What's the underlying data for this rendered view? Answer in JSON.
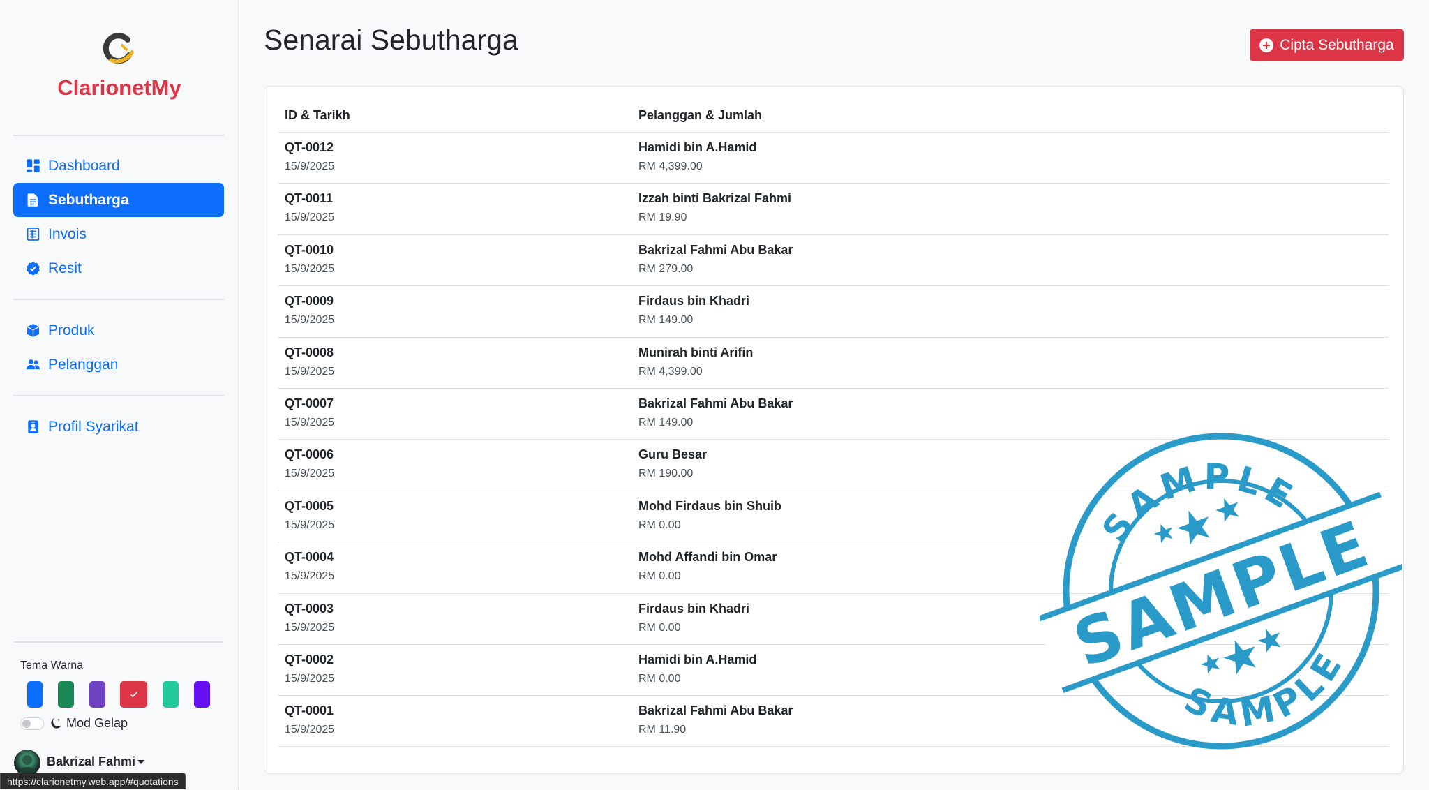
{
  "brand": {
    "name": "ClarionetMy",
    "color": "#dc3545",
    "logo_icon": "brand-logo-icon"
  },
  "sidebar": {
    "nav_main": [
      {
        "label": "Dashboard",
        "icon": "dashboard-icon",
        "active": false
      },
      {
        "label": "Sebutharga",
        "icon": "document-icon",
        "active": true
      },
      {
        "label": "Invois",
        "icon": "invoice-icon",
        "active": false
      },
      {
        "label": "Resit",
        "icon": "badge-check-icon",
        "active": false
      }
    ],
    "nav_data": [
      {
        "label": "Produk",
        "icon": "box-icon"
      },
      {
        "label": "Pelanggan",
        "icon": "people-icon"
      }
    ],
    "nav_settings": [
      {
        "label": "Profil Syarikat",
        "icon": "person-badge-icon"
      }
    ],
    "theme": {
      "label": "Tema Warna",
      "swatches": [
        "#0d6efd",
        "#198754",
        "#6f42c1",
        "#dc3545",
        "#20c997",
        "#6610f2"
      ],
      "selected_index": 3
    },
    "dark_mode": {
      "label": "Mod Gelap",
      "enabled": false
    },
    "user": {
      "name": "Bakrizal Fahmi"
    }
  },
  "status_bar": {
    "url": "https://clarionetmy.web.app/#quotations"
  },
  "main": {
    "title": "Senarai Sebutharga",
    "create_button": "Cipta Sebutharga",
    "table": {
      "headers": [
        "ID & Tarikh",
        "Pelanggan & Jumlah"
      ],
      "rows": [
        {
          "id": "QT-0012",
          "date": "15/9/2025",
          "customer": "Hamidi bin A.Hamid",
          "amount": "RM 4,399.00"
        },
        {
          "id": "QT-0011",
          "date": "15/9/2025",
          "customer": "Izzah binti Bakrizal Fahmi",
          "amount": "RM 19.90"
        },
        {
          "id": "QT-0010",
          "date": "15/9/2025",
          "customer": "Bakrizal Fahmi Abu Bakar",
          "amount": "RM 279.00"
        },
        {
          "id": "QT-0009",
          "date": "15/9/2025",
          "customer": "Firdaus bin Khadri",
          "amount": "RM 149.00"
        },
        {
          "id": "QT-0008",
          "date": "15/9/2025",
          "customer": "Munirah binti Arifin",
          "amount": "RM 4,399.00"
        },
        {
          "id": "QT-0007",
          "date": "15/9/2025",
          "customer": "Bakrizal Fahmi Abu Bakar",
          "amount": "RM 149.00"
        },
        {
          "id": "QT-0006",
          "date": "15/9/2025",
          "customer": "Guru Besar",
          "amount": "RM 190.00"
        },
        {
          "id": "QT-0005",
          "date": "15/9/2025",
          "customer": "Mohd Firdaus bin Shuib",
          "amount": "RM 0.00"
        },
        {
          "id": "QT-0004",
          "date": "15/9/2025",
          "customer": "Mohd Affandi bin Omar",
          "amount": "RM 0.00"
        },
        {
          "id": "QT-0003",
          "date": "15/9/2025",
          "customer": "Firdaus bin Khadri",
          "amount": "RM 0.00"
        },
        {
          "id": "QT-0002",
          "date": "15/9/2025",
          "customer": "Hamidi bin A.Hamid",
          "amount": "RM 0.00"
        },
        {
          "id": "QT-0001",
          "date": "15/9/2025",
          "customer": "Bakrizal Fahmi Abu Bakar",
          "amount": "RM 11.90"
        }
      ]
    }
  },
  "watermark": {
    "text_center": "SAMPLE",
    "text_top": "SAMPLE",
    "text_bottom": "SAMPLE",
    "color": "#2a9bc9"
  }
}
